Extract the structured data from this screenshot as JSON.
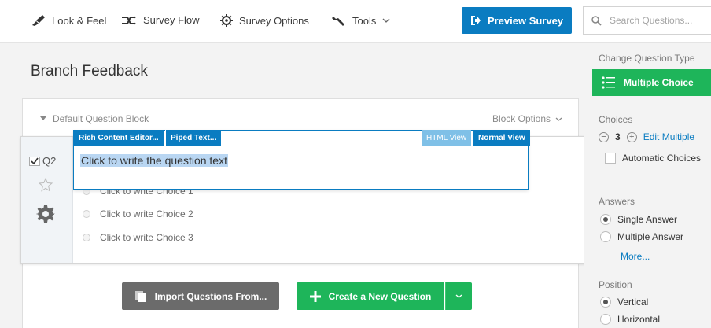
{
  "toolbar": {
    "look_feel": "Look & Feel",
    "survey_flow": "Survey Flow",
    "survey_options": "Survey Options",
    "tools": "Tools",
    "preview": "Preview Survey",
    "search_placeholder": "Search Questions..."
  },
  "main": {
    "title": "Branch Feedback",
    "block_name": "Default Question Block",
    "block_options": "Block Options"
  },
  "question": {
    "id": "Q2",
    "checked": true,
    "editor_tabs": {
      "rich": "Rich Content Editor...",
      "piped": "Piped Text...",
      "html": "HTML View",
      "normal": "Normal View"
    },
    "text": "Click to write the question text",
    "choices": [
      "Click to write Choice 1",
      "Click to write Choice 2",
      "Click to write Choice 3"
    ]
  },
  "actions": {
    "import": "Import Questions From...",
    "create": "Create a New Question"
  },
  "right_panel": {
    "change_type_label": "Change Question Type",
    "type_button": "Multiple Choice",
    "choices_label": "Choices",
    "choices_count": "3",
    "edit_multiple": "Edit Multiple",
    "automatic_choices": "Automatic Choices",
    "answers_label": "Answers",
    "answer_options": [
      "Single Answer",
      "Multiple Answer"
    ],
    "answer_selected": "Single Answer",
    "more": "More...",
    "position_label": "Position",
    "position_options": [
      "Vertical",
      "Horizontal"
    ],
    "position_selected": "Vertical"
  },
  "colors": {
    "primary_blue": "#0a7cc1",
    "green": "#1eb55a",
    "import_gray": "#6b6b6b"
  }
}
